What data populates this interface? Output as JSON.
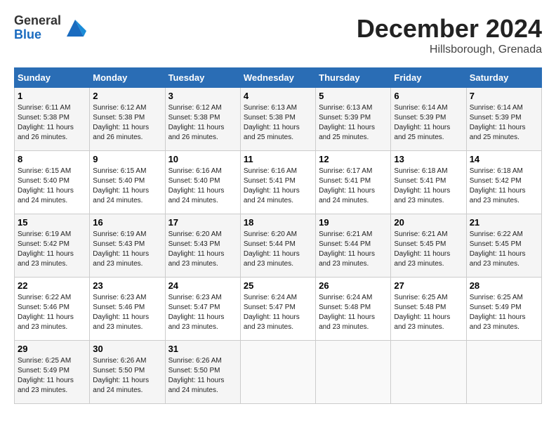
{
  "header": {
    "logo_line1": "General",
    "logo_line2": "Blue",
    "month": "December 2024",
    "location": "Hillsborough, Grenada"
  },
  "days_of_week": [
    "Sunday",
    "Monday",
    "Tuesday",
    "Wednesday",
    "Thursday",
    "Friday",
    "Saturday"
  ],
  "weeks": [
    [
      {
        "day": "1",
        "sunrise": "6:11 AM",
        "sunset": "5:38 PM",
        "daylight": "11 hours and 26 minutes."
      },
      {
        "day": "2",
        "sunrise": "6:12 AM",
        "sunset": "5:38 PM",
        "daylight": "11 hours and 26 minutes."
      },
      {
        "day": "3",
        "sunrise": "6:12 AM",
        "sunset": "5:38 PM",
        "daylight": "11 hours and 26 minutes."
      },
      {
        "day": "4",
        "sunrise": "6:13 AM",
        "sunset": "5:38 PM",
        "daylight": "11 hours and 25 minutes."
      },
      {
        "day": "5",
        "sunrise": "6:13 AM",
        "sunset": "5:39 PM",
        "daylight": "11 hours and 25 minutes."
      },
      {
        "day": "6",
        "sunrise": "6:14 AM",
        "sunset": "5:39 PM",
        "daylight": "11 hours and 25 minutes."
      },
      {
        "day": "7",
        "sunrise": "6:14 AM",
        "sunset": "5:39 PM",
        "daylight": "11 hours and 25 minutes."
      }
    ],
    [
      {
        "day": "8",
        "sunrise": "6:15 AM",
        "sunset": "5:40 PM",
        "daylight": "11 hours and 24 minutes."
      },
      {
        "day": "9",
        "sunrise": "6:15 AM",
        "sunset": "5:40 PM",
        "daylight": "11 hours and 24 minutes."
      },
      {
        "day": "10",
        "sunrise": "6:16 AM",
        "sunset": "5:40 PM",
        "daylight": "11 hours and 24 minutes."
      },
      {
        "day": "11",
        "sunrise": "6:16 AM",
        "sunset": "5:41 PM",
        "daylight": "11 hours and 24 minutes."
      },
      {
        "day": "12",
        "sunrise": "6:17 AM",
        "sunset": "5:41 PM",
        "daylight": "11 hours and 24 minutes."
      },
      {
        "day": "13",
        "sunrise": "6:18 AM",
        "sunset": "5:41 PM",
        "daylight": "11 hours and 23 minutes."
      },
      {
        "day": "14",
        "sunrise": "6:18 AM",
        "sunset": "5:42 PM",
        "daylight": "11 hours and 23 minutes."
      }
    ],
    [
      {
        "day": "15",
        "sunrise": "6:19 AM",
        "sunset": "5:42 PM",
        "daylight": "11 hours and 23 minutes."
      },
      {
        "day": "16",
        "sunrise": "6:19 AM",
        "sunset": "5:43 PM",
        "daylight": "11 hours and 23 minutes."
      },
      {
        "day": "17",
        "sunrise": "6:20 AM",
        "sunset": "5:43 PM",
        "daylight": "11 hours and 23 minutes."
      },
      {
        "day": "18",
        "sunrise": "6:20 AM",
        "sunset": "5:44 PM",
        "daylight": "11 hours and 23 minutes."
      },
      {
        "day": "19",
        "sunrise": "6:21 AM",
        "sunset": "5:44 PM",
        "daylight": "11 hours and 23 minutes."
      },
      {
        "day": "20",
        "sunrise": "6:21 AM",
        "sunset": "5:45 PM",
        "daylight": "11 hours and 23 minutes."
      },
      {
        "day": "21",
        "sunrise": "6:22 AM",
        "sunset": "5:45 PM",
        "daylight": "11 hours and 23 minutes."
      }
    ],
    [
      {
        "day": "22",
        "sunrise": "6:22 AM",
        "sunset": "5:46 PM",
        "daylight": "11 hours and 23 minutes."
      },
      {
        "day": "23",
        "sunrise": "6:23 AM",
        "sunset": "5:46 PM",
        "daylight": "11 hours and 23 minutes."
      },
      {
        "day": "24",
        "sunrise": "6:23 AM",
        "sunset": "5:47 PM",
        "daylight": "11 hours and 23 minutes."
      },
      {
        "day": "25",
        "sunrise": "6:24 AM",
        "sunset": "5:47 PM",
        "daylight": "11 hours and 23 minutes."
      },
      {
        "day": "26",
        "sunrise": "6:24 AM",
        "sunset": "5:48 PM",
        "daylight": "11 hours and 23 minutes."
      },
      {
        "day": "27",
        "sunrise": "6:25 AM",
        "sunset": "5:48 PM",
        "daylight": "11 hours and 23 minutes."
      },
      {
        "day": "28",
        "sunrise": "6:25 AM",
        "sunset": "5:49 PM",
        "daylight": "11 hours and 23 minutes."
      }
    ],
    [
      {
        "day": "29",
        "sunrise": "6:25 AM",
        "sunset": "5:49 PM",
        "daylight": "11 hours and 23 minutes."
      },
      {
        "day": "30",
        "sunrise": "6:26 AM",
        "sunset": "5:50 PM",
        "daylight": "11 hours and 24 minutes."
      },
      {
        "day": "31",
        "sunrise": "6:26 AM",
        "sunset": "5:50 PM",
        "daylight": "11 hours and 24 minutes."
      },
      null,
      null,
      null,
      null
    ]
  ],
  "labels": {
    "sunrise": "Sunrise:",
    "sunset": "Sunset:",
    "daylight": "Daylight:"
  }
}
